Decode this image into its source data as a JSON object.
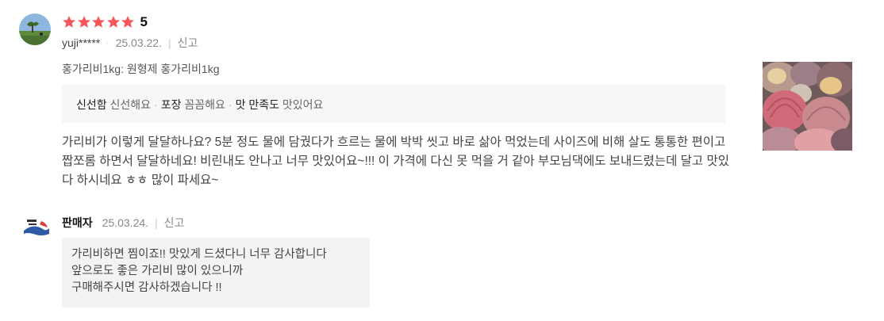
{
  "review": {
    "rating": "5",
    "rating_value": 5,
    "user": "yuji*****",
    "date": "25.03.22.",
    "report": "신고",
    "option": "홍가리비1kg: 원형제 홍가리비1kg",
    "evaluation": [
      {
        "key": "신선함",
        "value": "신선해요"
      },
      {
        "key": "포장",
        "value": "꼼꼼해요"
      },
      {
        "key": "맛 만족도",
        "value": "맛있어요"
      }
    ],
    "text": "가리비가 이렇게 달달하나요? 5분 정도 물에 담궜다가 흐르는 물에 박박 씻고 바로 삶아 먹었는데 사이즈에 비해 살도 통통한 편이고 짭쪼롬 하면서 달달하네요! 비린내도 안나고 너무 맛있어요~!!! 이 가격에 다신 못 먹을 거 같아 부모님댁에도 보내드렸는데 달고 맛있다 하시네요 ㅎㅎ 많이 파세요~"
  },
  "seller_reply": {
    "name": "판매자",
    "date": "25.03.24.",
    "report": "신고",
    "lines": [
      "가리비하면 찜이죠!! 맛있게 드셨다니 너무 감사합니다",
      "앞으로도 좋은 가리비 많이 있으니까",
      "구매해주시면 감사하겠습니다 !!"
    ]
  },
  "colors": {
    "star": "#f5565c",
    "eval_bg": "#f7f7f8",
    "reply_bg": "#f2f3f5"
  },
  "icons": {
    "star": "star-icon",
    "avatar": "user-avatar",
    "seller_logo": "seller-logo",
    "photo": "review-photo"
  }
}
